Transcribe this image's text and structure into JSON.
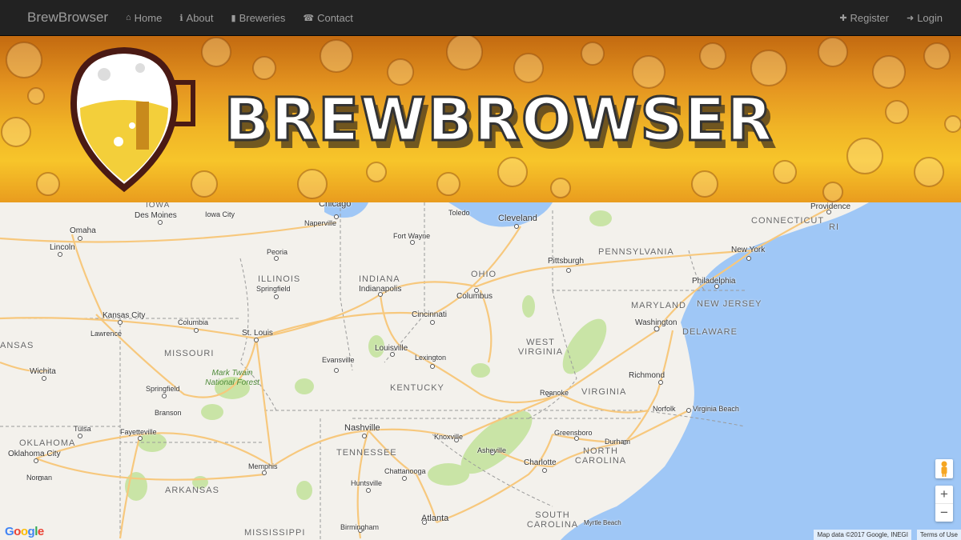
{
  "navbar": {
    "brand": "BrewBrowser",
    "left_items": [
      {
        "icon": "home-icon",
        "glyph": "⌂",
        "label": "Home"
      },
      {
        "icon": "info-icon",
        "glyph": "ℹ",
        "label": "About"
      },
      {
        "icon": "beer-icon",
        "glyph": "▮",
        "label": "Breweries"
      },
      {
        "icon": "phone-icon",
        "glyph": "☎",
        "label": "Contact"
      }
    ],
    "right_items": [
      {
        "icon": "user-plus-icon",
        "glyph": "✚",
        "label": "Register"
      },
      {
        "icon": "login-icon",
        "glyph": "➜",
        "label": "Login"
      }
    ]
  },
  "banner": {
    "wordmark": "BREWBROWSER"
  },
  "map": {
    "colors": {
      "land": "#f3f1ec",
      "water": "#9fc7f6",
      "road": "#f7c87d",
      "park": "#c9e4a6",
      "border": "#9a9a9a"
    },
    "cities": [
      "Chicago",
      "Toledo",
      "Cleveland",
      "Providence",
      "Des Moines",
      "Iowa City",
      "Naperville",
      "Omaha",
      "Fort Wayne",
      "Lincoln",
      "Peoria",
      "Pittsburgh",
      "New York",
      "Springfield",
      "Indianapolis",
      "Columbus",
      "Philadelphia",
      "Kansas City",
      "Cincinnati",
      "Columbia",
      "Washington",
      "Lawrence",
      "St. Louis",
      "Wichita",
      "Evansville",
      "Louisville",
      "Lexington",
      "Richmond",
      "Springfield",
      "Roanoke",
      "Branson",
      "Norfolk",
      "Virginia Beach",
      "Tulsa",
      "Fayetteville",
      "Nashville",
      "Knoxville",
      "Greensboro",
      "Durham",
      "Oklahoma City",
      "Asheville",
      "Charlotte",
      "Norman",
      "Memphis",
      "Chattanooga",
      "Huntsville",
      "Atlanta",
      "Birmingham",
      "Myrtle Beach"
    ],
    "states": [
      "IOWA",
      "CONNECTICUT",
      "RI",
      "PENNSYLVANIA",
      "OHIO",
      "ILLINOIS",
      "INDIANA",
      "MARYLAND",
      "NEW JERSEY",
      "ANSAS",
      "MISSOURI",
      "DELAWARE",
      "WEST VIRGINIA",
      "KENTUCKY",
      "VIRGINIA",
      "OKLAHOMA",
      "TENNESSEE",
      "NORTH CAROLINA",
      "ARKANSAS",
      "SOUTH CAROLINA",
      "MISSISSIPPI"
    ],
    "park": "Mark Twain National Forest",
    "google": "Google",
    "attribution": "Map data ©2017 Google, INEGI",
    "terms": "Terms of Use",
    "zoom_in": "+",
    "zoom_out": "−"
  }
}
